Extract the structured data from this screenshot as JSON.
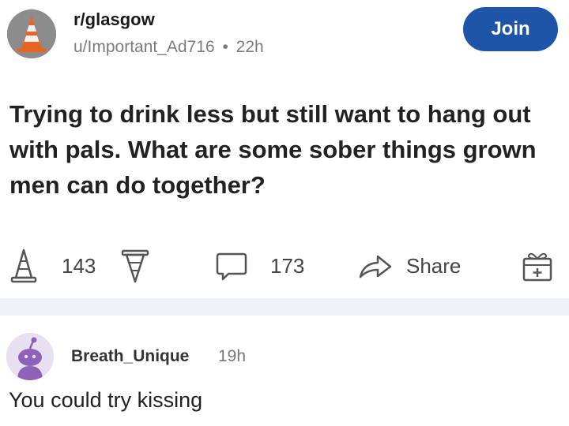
{
  "header": {
    "subreddit": "r/glasgow",
    "author": "u/Important_Ad716",
    "separator": "•",
    "time": "22h",
    "join_label": "Join"
  },
  "post": {
    "title": "Trying to drink less but still want to hang out with pals. What are some sober things grown men can do together?"
  },
  "actions": {
    "upvote_count": "143",
    "comment_count": "173",
    "share_label": "Share"
  },
  "comment": {
    "username": "Breath_Unique",
    "time": "19h",
    "text": "You could try kissing"
  },
  "colors": {
    "join_button": "#1f55a8",
    "avatar_cone": "#e8641f",
    "comment_avatar": "#8e62b8"
  },
  "icons": {
    "subreddit_avatar": "traffic-cone-icon",
    "upvote": "cone-upvote-icon",
    "downvote": "cone-downvote-icon",
    "comment": "comment-bubble-icon",
    "share": "share-arrow-icon",
    "award": "gift-award-icon",
    "user_avatar": "snoo-avatar-icon"
  }
}
